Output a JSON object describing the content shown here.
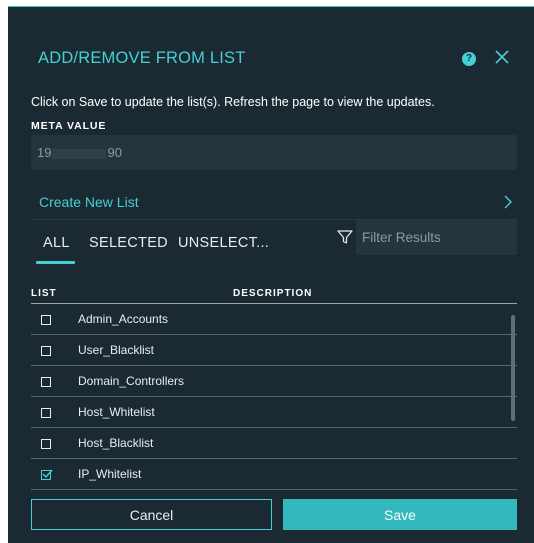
{
  "dialog": {
    "title": "ADD/REMOVE FROM LIST",
    "help_icon": "help-circle-icon",
    "help_glyph": "?",
    "close_icon": "close-icon",
    "instructions": "Click on Save to update the list(s). Refresh the page to view the updates."
  },
  "meta": {
    "label": "META VALUE",
    "value_start": "19",
    "value_end": "90",
    "value_masked": true
  },
  "create_list": {
    "label": "Create New List",
    "icon": "chevron-right-icon"
  },
  "tabs": [
    {
      "label": "ALL",
      "active": true
    },
    {
      "label": "SELECTED",
      "active": false
    },
    {
      "label": "UNSELECT...",
      "active": false
    }
  ],
  "filter": {
    "icon": "filter-icon",
    "placeholder": "Filter Results",
    "value": ""
  },
  "table": {
    "columns": [
      "LIST",
      "DESCRIPTION"
    ],
    "rows": [
      {
        "name": "Admin_Accounts",
        "checked": false
      },
      {
        "name": "User_Blacklist",
        "checked": false
      },
      {
        "name": "Domain_Controllers",
        "checked": false
      },
      {
        "name": "Host_Whitelist",
        "checked": false
      },
      {
        "name": "Host_Blacklist",
        "checked": false
      },
      {
        "name": "IP_Whitelist",
        "checked": true
      }
    ]
  },
  "buttons": {
    "cancel": "Cancel",
    "save": "Save"
  },
  "colors": {
    "background": "#1b2a32",
    "accent": "#43d1d4",
    "save_button": "#31b9bd",
    "field": "#25353e"
  }
}
